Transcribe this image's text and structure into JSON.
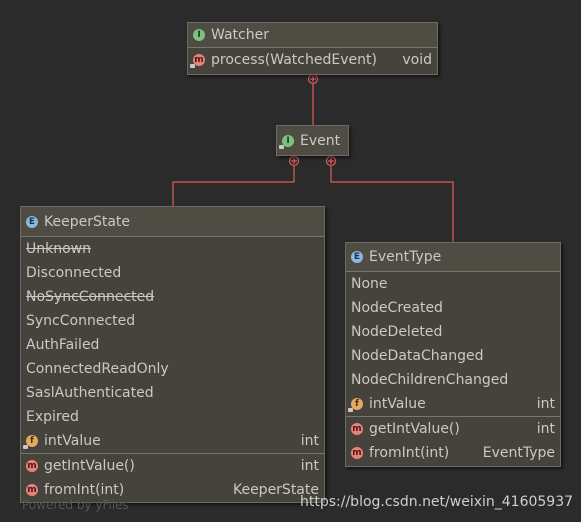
{
  "watcher": {
    "name": "Watcher",
    "kind_icon": "interface-icon",
    "methods": [
      {
        "name": "process(WatchedEvent)",
        "type": "void"
      }
    ]
  },
  "event": {
    "name": "Event",
    "kind_icon": "interface-icon"
  },
  "keeper_state": {
    "name": "KeeperState",
    "kind_icon": "enum-icon",
    "constants": [
      {
        "name": "Unknown",
        "deprecated": true
      },
      {
        "name": "Disconnected",
        "deprecated": false
      },
      {
        "name": "NoSyncConnected",
        "deprecated": true
      },
      {
        "name": "SyncConnected",
        "deprecated": false
      },
      {
        "name": "AuthFailed",
        "deprecated": false
      },
      {
        "name": "ConnectedReadOnly",
        "deprecated": false
      },
      {
        "name": "SaslAuthenticated",
        "deprecated": false
      },
      {
        "name": "Expired",
        "deprecated": false
      }
    ],
    "fields": [
      {
        "name": "intValue",
        "type": "int"
      }
    ],
    "methods": [
      {
        "name": "getIntValue()",
        "type": "int"
      },
      {
        "name": "fromInt(int)",
        "type": "KeeperState"
      }
    ]
  },
  "event_type": {
    "name": "EventType",
    "kind_icon": "enum-icon",
    "constants": [
      {
        "name": "None"
      },
      {
        "name": "NodeCreated"
      },
      {
        "name": "NodeDeleted"
      },
      {
        "name": "NodeDataChanged"
      },
      {
        "name": "NodeChildrenChanged"
      }
    ],
    "fields": [
      {
        "name": "intValue",
        "type": "int"
      }
    ],
    "methods": [
      {
        "name": "getIntValue()",
        "type": "int"
      },
      {
        "name": "fromInt(int)",
        "type": "EventType"
      }
    ]
  },
  "edge_color": "#e05a5a",
  "watermark": "https://blog.csdn.net/weixin_41605937",
  "powered_by": "Powered by yFiles"
}
